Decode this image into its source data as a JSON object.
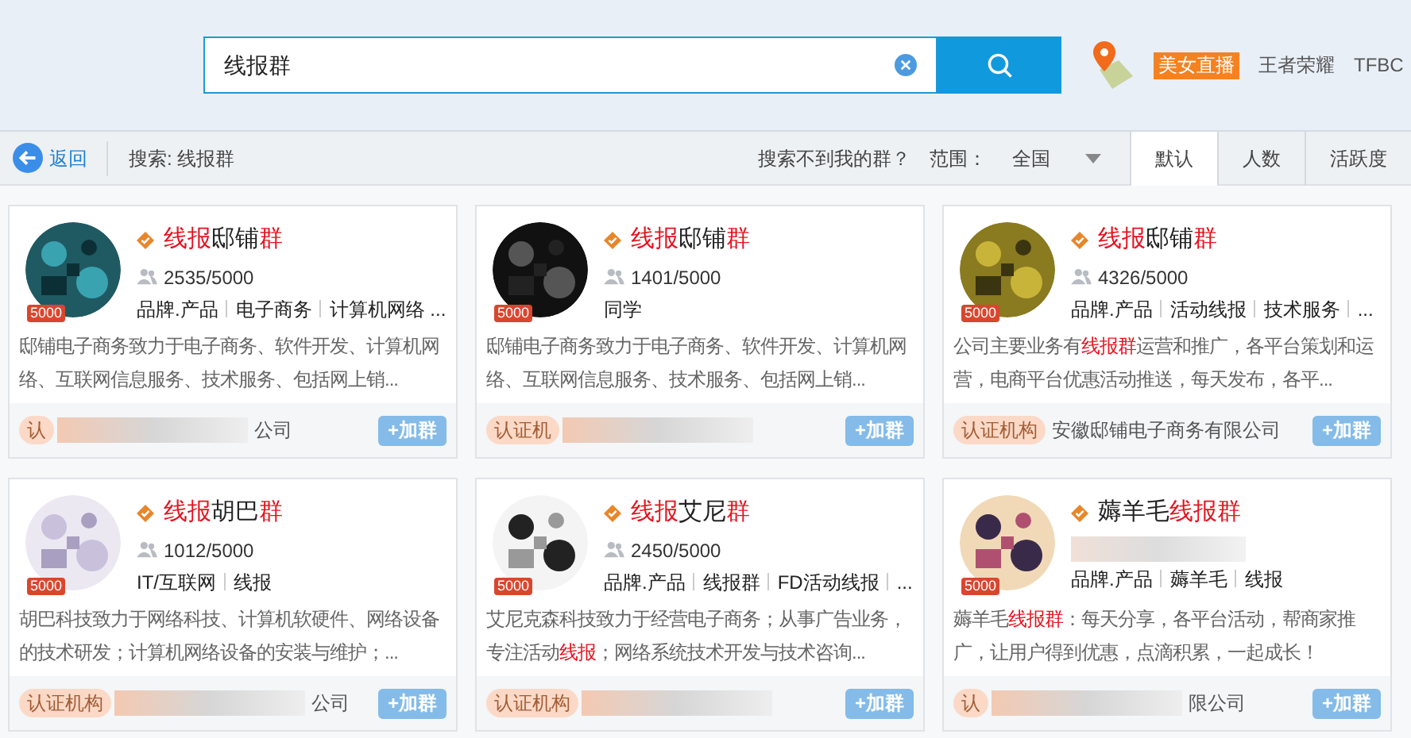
{
  "search": {
    "value": "线报群"
  },
  "header_links": [
    {
      "label": "美女直播",
      "kind": "badge"
    },
    {
      "label": "王者荣耀",
      "kind": "link"
    },
    {
      "label": "TFBC",
      "kind": "link"
    }
  ],
  "toolbar": {
    "back": "返回",
    "query": "搜索: 线报群",
    "help": "搜索不到我的群？",
    "scope_label": "范围：",
    "scope": "全国"
  },
  "sort_tabs": [
    {
      "label": "默认",
      "selected": true
    },
    {
      "label": "人数",
      "selected": false
    },
    {
      "label": "活跃度",
      "selected": false
    }
  ],
  "groups": [
    {
      "level_badge": "5000",
      "title": [
        {
          "text": "线报",
          "hl": true
        },
        {
          "text": "邸铺",
          "hl": false
        },
        {
          "text": "群",
          "hl": true
        }
      ],
      "members": "2535/5000",
      "tags": [
        "品牌.产品",
        "电子商务",
        "计算机网络 ..."
      ],
      "description": [
        {
          "text": "邸铺电子商务致力于电子商务、软件开发、计算机网络、互联网信息服务、技术服务、包括网上销...",
          "hl": false
        }
      ],
      "cert": "认",
      "company": "公司",
      "blurred": true,
      "join": "+加群"
    },
    {
      "level_badge": "5000",
      "title": [
        {
          "text": "线报",
          "hl": true
        },
        {
          "text": "邸铺",
          "hl": false
        },
        {
          "text": "群",
          "hl": true
        }
      ],
      "members": "1401/5000",
      "tags": [
        "同学"
      ],
      "description": [
        {
          "text": "邸铺电子商务致力于电子商务、软件开发、计算机网络、互联网信息服务、技术服务、包括网上销...",
          "hl": false
        }
      ],
      "cert": "认证机",
      "blurred": true,
      "join": "+加群"
    },
    {
      "level_badge": "5000",
      "title": [
        {
          "text": "线报",
          "hl": true
        },
        {
          "text": "邸铺",
          "hl": false
        },
        {
          "text": "群",
          "hl": true
        }
      ],
      "members": "4326/5000",
      "tags": [
        "品牌.产品",
        "活动线报",
        "技术服务",
        "..."
      ],
      "description": [
        {
          "text": "公司主要业务有",
          "hl": false
        },
        {
          "text": "线报群",
          "hl": true
        },
        {
          "text": "运营和推广，各平台策划和运营，电商平台优惠活动推送，每天发布，各平...",
          "hl": false
        }
      ],
      "cert": "认证机构",
      "company": "安徽邸铺电子商务有限公司",
      "blurred": false,
      "join": "+加群"
    },
    {
      "level_badge": "5000",
      "title": [
        {
          "text": "线报",
          "hl": true
        },
        {
          "text": "胡巴",
          "hl": false
        },
        {
          "text": "群",
          "hl": true
        }
      ],
      "members": "1012/5000",
      "tags": [
        "IT/互联网",
        "线报"
      ],
      "description": [
        {
          "text": "胡巴科技致力于网络科技、计算机软硬件、网络设备的技术研发；计算机网络设备的安装与维护；...",
          "hl": false
        }
      ],
      "cert": "认证机构",
      "company": "公司",
      "blurred": true,
      "join": "+加群"
    },
    {
      "level_badge": "5000",
      "title": [
        {
          "text": "线报",
          "hl": true
        },
        {
          "text": "艾尼",
          "hl": false
        },
        {
          "text": "群",
          "hl": true
        }
      ],
      "members": "2450/5000",
      "tags": [
        "品牌.产品",
        "线报群",
        "FD活动线报",
        "..."
      ],
      "description": [
        {
          "text": "艾尼克森科技致力于经营电子商务；从事广告业务，专注活动",
          "hl": false
        },
        {
          "text": "线报",
          "hl": true
        },
        {
          "text": "；网络系统技术开发与技术咨询...",
          "hl": false
        }
      ],
      "cert": "认证机构",
      "blurred": true,
      "join": "+加群"
    },
    {
      "level_badge": "5000",
      "title": [
        {
          "text": "薅羊毛",
          "hl": false
        },
        {
          "text": "线报群",
          "hl": true
        }
      ],
      "tags": [
        "品牌.产品",
        "薅羊毛",
        "线报"
      ],
      "description": [
        {
          "text": "薅羊毛",
          "hl": false
        },
        {
          "text": "线报群",
          "hl": true
        },
        {
          "text": "：每天分享，各平台活动，帮商家推广，让用户得到优惠，点滴积累，一起成长！",
          "hl": false
        }
      ],
      "cert": "认",
      "company": "限公司",
      "blurred": true,
      "join": "+加群"
    }
  ]
}
